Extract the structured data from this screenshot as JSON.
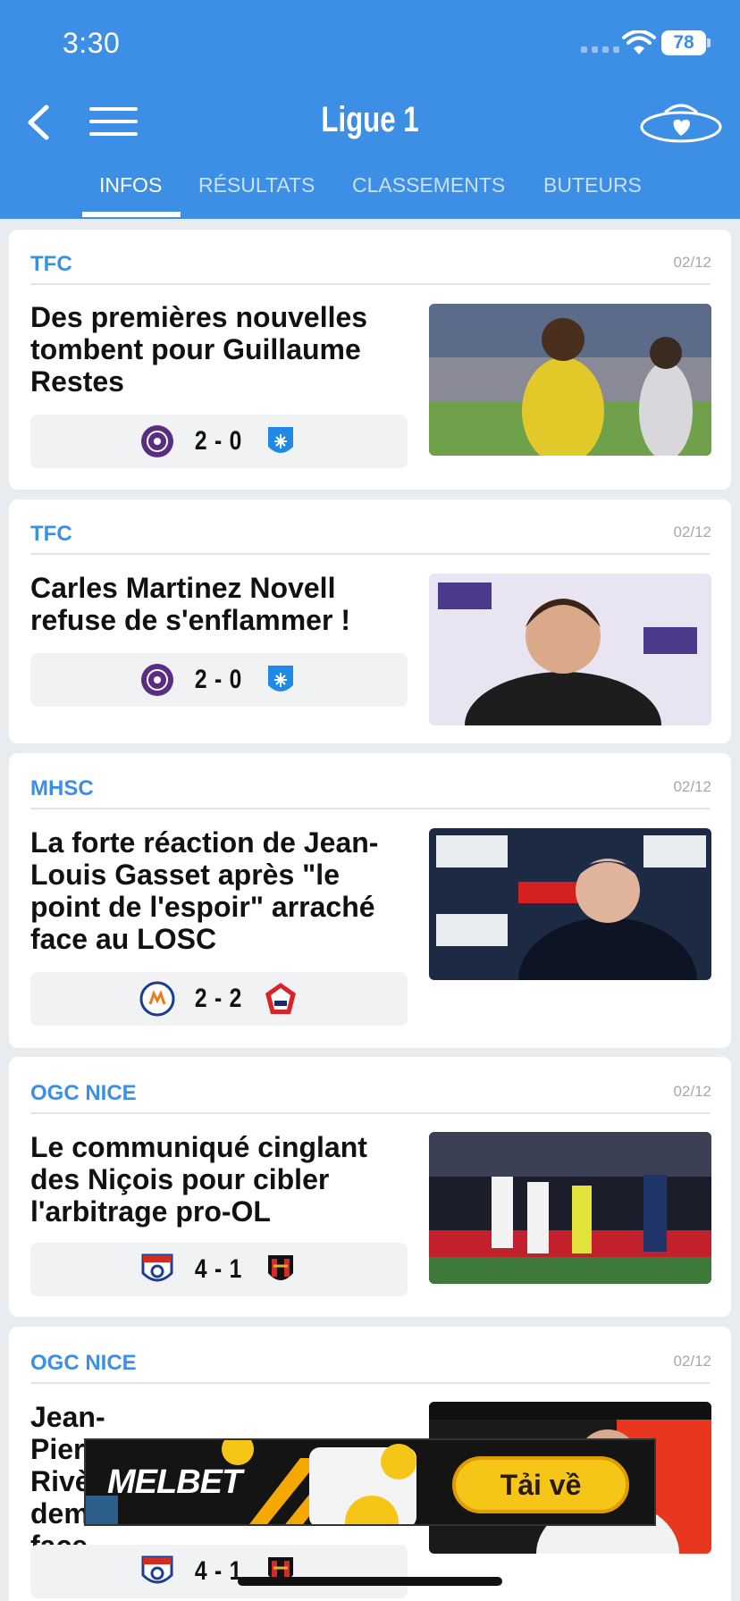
{
  "status_bar": {
    "time": "3:30",
    "battery": "78"
  },
  "header": {
    "title": "Ligue 1"
  },
  "tabs": [
    {
      "label": "INFOS",
      "active": true
    },
    {
      "label": "RÉSULTATS",
      "active": false
    },
    {
      "label": "CLASSEMENTS",
      "active": false
    },
    {
      "label": "BUTEURS",
      "active": false
    }
  ],
  "articles": [
    {
      "team": "TFC",
      "date": "02/12",
      "headline": "Des premières nouvelles tombent pour Guillaume Restes",
      "score": "2 - 0",
      "home_logo": "toulouse-logo",
      "away_logo": "auxerre-logo"
    },
    {
      "team": "TFC",
      "date": "02/12",
      "headline": "Carles Martinez Novell refuse de s'enflammer !",
      "score": "2 - 0",
      "home_logo": "toulouse-logo",
      "away_logo": "auxerre-logo"
    },
    {
      "team": "MHSC",
      "date": "02/12",
      "headline": "La forte réaction de Jean-Louis Gasset après \"le point de l'espoir\" arraché face au LOSC",
      "score": "2 - 2",
      "home_logo": "montpellier-logo",
      "away_logo": "lille-logo"
    },
    {
      "team": "OGC NICE",
      "date": "02/12",
      "headline": "Le communiqué cinglant des Niçois pour cibler l'arbitrage pro-OL",
      "score": "4 - 1",
      "home_logo": "lyon-logo",
      "away_logo": "nice-logo"
    },
    {
      "team": "OGC NICE",
      "date": "02/12",
      "headline": "Jean-Pierre Rivère dem arbi face",
      "score": "4 - 1",
      "home_logo": "lyon-logo",
      "away_logo": "nice-logo"
    }
  ],
  "ad": {
    "brand": "MELBET",
    "cta": "Tải về"
  },
  "colors": {
    "primary": "#3d8fe6",
    "background": "#e9ecef",
    "card": "#ffffff"
  }
}
